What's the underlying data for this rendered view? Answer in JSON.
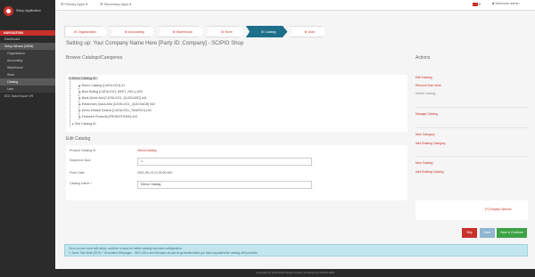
{
  "app": {
    "brand": "Setup Application"
  },
  "topbar": {
    "primary_apps": "Primary Apps",
    "secondary_apps": "Secondary Apps",
    "welcome": "Welcome admin"
  },
  "sidebar": {
    "heading": "NAVIGATION",
    "items": [
      {
        "label": "Dashboard"
      },
      {
        "label": "Setup Wizard (NEW)"
      },
      {
        "label": "Organization"
      },
      {
        "label": "Accounting"
      },
      {
        "label": "Warehouse"
      },
      {
        "label": "Store"
      },
      {
        "label": "Catalog"
      },
      {
        "label": "User"
      },
      {
        "label": "EDI: Data Export VR"
      }
    ]
  },
  "steps": [
    "Organization",
    "Accounting",
    "Warehouse",
    "Store",
    "Catalog",
    "User"
  ],
  "active_step": "Catalog",
  "page_title": "Setting up: Your Company Name Here [Party ID: Company] - SCIPIO Shop",
  "browse_heading": "Browse Catalogs/Categories",
  "tree": [
    {
      "label": "Demo Catalog #1"
    },
    {
      "label": "Demo Catalog [CATALOG1] #1"
    },
    {
      "label": "Best Selling [CATALOG1_BEST_SELL] #20"
    },
    {
      "label": "Back Quick Add [CATALOG1_QUICKADD] #41"
    },
    {
      "label": "Electronics Quick Add [CATALOG1_QUICKADD] #42"
    },
    {
      "label": "Demo Default Search [CATALOG1_SEARCH] #43"
    },
    {
      "label": "Featured Products [PROMOTIONS] #10"
    },
    {
      "label": "Test Catalog #1"
    }
  ],
  "edit_heading": "Edit Catalog",
  "form": {
    "product_catalog_id_label": "Product Catalog ID",
    "product_catalog_id": "DemoCatalog",
    "sequence_num_label": "Sequence Num",
    "sequence_num": "1",
    "from_date_label": "From Date",
    "from_date": "2001-05-13 12:00:00.000",
    "catalog_name_label": "Catalog Name *",
    "catalog_name": "Demo Catalog"
  },
  "actions_heading": "Actions",
  "actions": {
    "group1": [
      "Edit Catalog",
      "Remove from store",
      "Delete Catalog"
    ],
    "group2": [
      "Manage Catalog"
    ],
    "group3": [
      "New Category",
      "Add Existing Category"
    ],
    "group4": [
      "New Catalog",
      "Add Existing Catalog"
    ]
  },
  "display_options": "Display Options",
  "buttons": {
    "skip": "Skip",
    "save": "Save",
    "save_continue": "Save & Continue"
  },
  "info": {
    "line1": "Once you are done with steps, continue to apps for further catalog and store configuration.",
    "line2": "1. Some Site Wide (SEO) + Generated Webpages - SEO URLs and Sitemaps should be generated after you have populated the catalog with products"
  },
  "footer": "Copyright (c) 2014-2018 Ilscipio GmbH | Powered by SCIPIO ERP",
  "colors": {
    "accent": "#c9302c",
    "active_step": "#1d6f8a",
    "sidebar_bg": "#2b2b2b",
    "info_bg": "#c2e6ee",
    "btn_save_continue": "#3ca344",
    "btn_skip": "#c9302c",
    "btn_save": "#8fb7d2"
  }
}
